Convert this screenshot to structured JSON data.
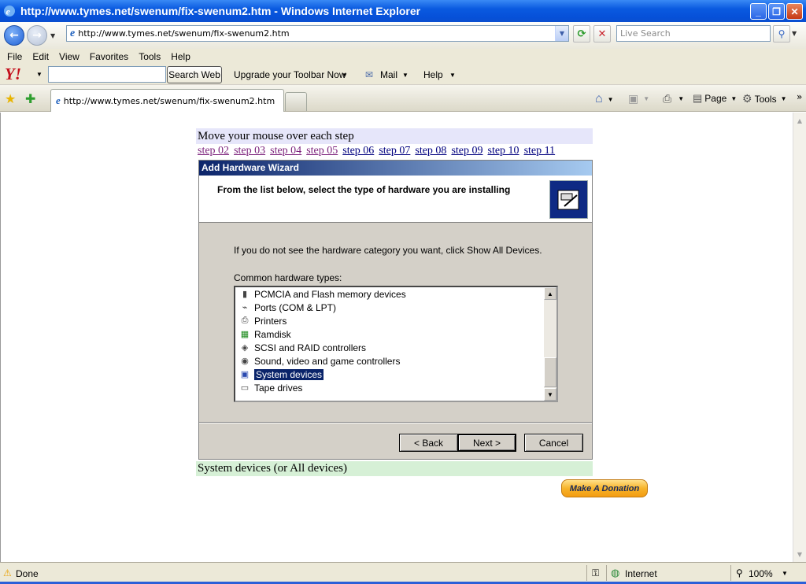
{
  "window": {
    "title": "http://www.tymes.net/swenum/fix-swenum2.htm - Windows Internet Explorer"
  },
  "address": {
    "url": "http://www.tymes.net/swenum/fix-swenum2.htm",
    "search_placeholder": "Live Search"
  },
  "menu": [
    "File",
    "Edit",
    "View",
    "Favorites",
    "Tools",
    "Help"
  ],
  "yahoo": {
    "logo": "Y!",
    "search_button": "Search Web",
    "upgrade": "Upgrade your Toolbar Now",
    "mail": "Mail",
    "help": "Help"
  },
  "tab": {
    "label": "http://www.tymes.net/swenum/fix-swenum2.htm"
  },
  "commands": {
    "page": "Page",
    "tools": "Tools"
  },
  "page": {
    "instruction": "Move your mouse over each step",
    "steps": [
      "step 02",
      "step 03",
      "step 04",
      "step 05",
      "step 06",
      "step 07",
      "step 08",
      "step 09",
      "step 10",
      "step 11"
    ],
    "caption": "System devices (or All devices)",
    "donate": "Make A Donation"
  },
  "wizard": {
    "title": "Add Hardware Wizard",
    "header": "From the list below, select the type of hardware you are installing",
    "hint": "If you do not see the hardware category you want, click Show All Devices.",
    "list_label": "Common hardware types:",
    "items": [
      "PCMCIA and Flash memory devices",
      "Ports (COM & LPT)",
      "Printers",
      "Ramdisk",
      "SCSI and RAID controllers",
      "Sound, video and game controllers",
      "System devices",
      "Tape drives"
    ],
    "selected": "System devices",
    "back": "< Back",
    "next": "Next >",
    "cancel": "Cancel"
  },
  "status": {
    "text": "Done",
    "zone": "Internet",
    "zoom": "100%"
  }
}
